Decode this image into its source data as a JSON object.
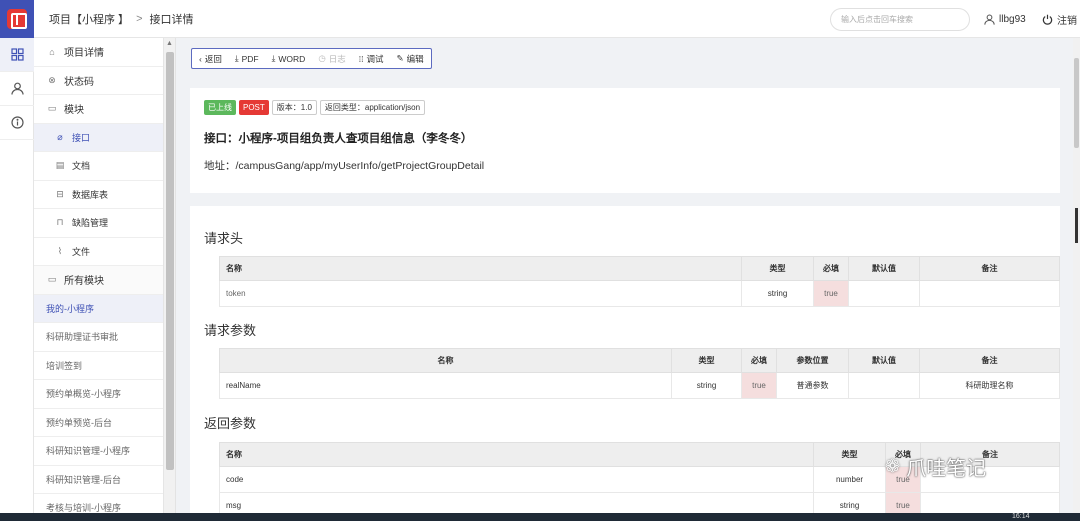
{
  "header": {
    "breadcrumb": [
      "项目【小程序 】",
      "接口详情"
    ],
    "breadcrumb_sep": ">",
    "search_placeholder": "输入后点击回车搜索",
    "username": "llbg93",
    "logout": "注销"
  },
  "rail": {
    "icons": [
      "grid-icon",
      "user-icon",
      "info-icon"
    ]
  },
  "sidebar": {
    "items": [
      {
        "label": "项目详情",
        "icon": "home-icon"
      },
      {
        "label": "状态码",
        "icon": "close-circle-icon"
      },
      {
        "label": "模块",
        "icon": "folder-icon"
      },
      {
        "label": "接口",
        "icon": "link-icon"
      },
      {
        "label": "文档",
        "icon": "document-icon"
      },
      {
        "label": "数据库表",
        "icon": "database-icon"
      },
      {
        "label": "缺陷管理",
        "icon": "lock-icon"
      },
      {
        "label": "文件",
        "icon": "paperclip-icon"
      },
      {
        "label": "所有模块",
        "icon": "folder-icon"
      }
    ],
    "modules": [
      "我的-小程序",
      "科研助理证书审批",
      "培训签到",
      "预约单概览-小程序",
      "预约单预览-后台",
      "科研知识管理-小程序",
      "科研知识管理-后台",
      "考核与培训-小程序"
    ]
  },
  "toolbar": {
    "back": "返回",
    "pdf": "PDF",
    "word": "WORD",
    "log": "日志",
    "debug": "调试",
    "edit": "编辑"
  },
  "api": {
    "status": "已上线",
    "method": "POST",
    "version": "版本：1.0",
    "return_type": "返回类型：application/json",
    "title": "接口：小程序-项目组负责人查项目组信息（李冬冬）",
    "address": "地址：/campusGang/app/myUserInfo/getProjectGroupDetail"
  },
  "request_header": {
    "title": "请求头",
    "columns": [
      "名称",
      "类型",
      "必填",
      "默认值",
      "备注"
    ],
    "rows": [
      [
        "token",
        "string",
        "true",
        "",
        ""
      ]
    ]
  },
  "request_params": {
    "title": "请求参数",
    "columns": [
      "名称",
      "类型",
      "必填",
      "参数位置",
      "默认值",
      "备注"
    ],
    "rows": [
      [
        "realName",
        "string",
        "true",
        "普通参数",
        "",
        "科研助理名称"
      ]
    ]
  },
  "response_params": {
    "title": "返回参数",
    "columns": [
      "名称",
      "类型",
      "必填",
      "备注"
    ],
    "rows": [
      [
        "code",
        "number",
        "true",
        ""
      ],
      [
        "msg",
        "string",
        "true",
        ""
      ]
    ]
  },
  "watermark": "爪哇笔记",
  "clock": "16:14",
  "colors": {
    "accent": "#3f51b5",
    "online": "#5cb85c",
    "method": "#e53935",
    "required_bg": "#f5dede"
  }
}
